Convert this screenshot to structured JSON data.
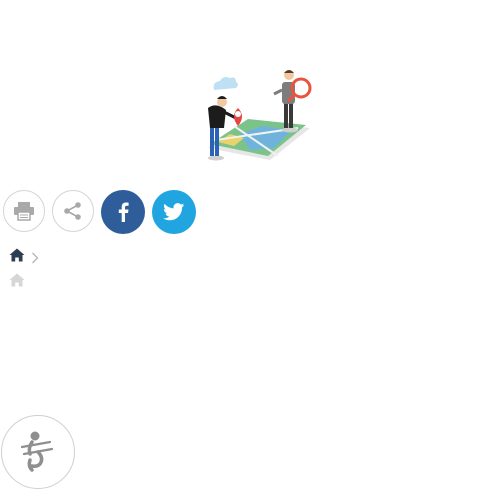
{
  "hero": {
    "icon": "map-search-illustration-icon"
  },
  "share": {
    "buttons": [
      {
        "icon": "print-icon",
        "color": "#a9a9a9"
      },
      {
        "icon": "share-icon",
        "color": "#a9a9a9"
      },
      {
        "icon": "facebook-icon",
        "color": "#2e5d9a"
      },
      {
        "icon": "twitter-icon",
        "color": "#21a5e0"
      }
    ]
  },
  "breadcrumb": {
    "home_icon": "home-icon",
    "separator_icon": "chevron-right-icon",
    "home_color": "#2c3e50"
  },
  "secondary": {
    "home_icon": "home-icon",
    "color": "#d6d6d6"
  },
  "fab": {
    "icon": "accessibility-figure-icon",
    "color": "#8f8f8f"
  }
}
